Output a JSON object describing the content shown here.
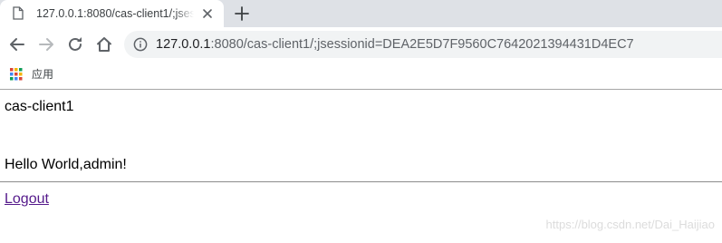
{
  "browser": {
    "tab": {
      "title": "127.0.0.1:8080/cas-client1/;jsessionid=DEA2E5D7F9560C7642021394431D4EC7",
      "favicon": "page-icon",
      "close": "close-icon"
    },
    "new_tab": "plus-icon",
    "nav": {
      "back": "back-arrow-icon",
      "forward": "forward-arrow-icon",
      "reload": "reload-icon",
      "home": "home-icon"
    },
    "address": {
      "security": "info-icon",
      "host": "127.0.0.1",
      "rest": ":8080/cas-client1/;jsessionid=DEA2E5D7F9560C7642021394431D4EC7"
    },
    "bookmarks": {
      "apps_label": "应用",
      "apps_colors": [
        "#db4437",
        "#f4b400",
        "#0f9d58",
        "#4285f4"
      ]
    }
  },
  "page": {
    "site_name": "cas-client1",
    "greeting": "Hello World,admin!",
    "logout_link": "Logout",
    "watermark": "https://blog.csdn.net/Dai_Haijiao"
  },
  "colors": {
    "link_visited": "#551a8b",
    "tabbar_bg": "#dee1e6",
    "omnibox_bg": "#f1f3f4"
  }
}
